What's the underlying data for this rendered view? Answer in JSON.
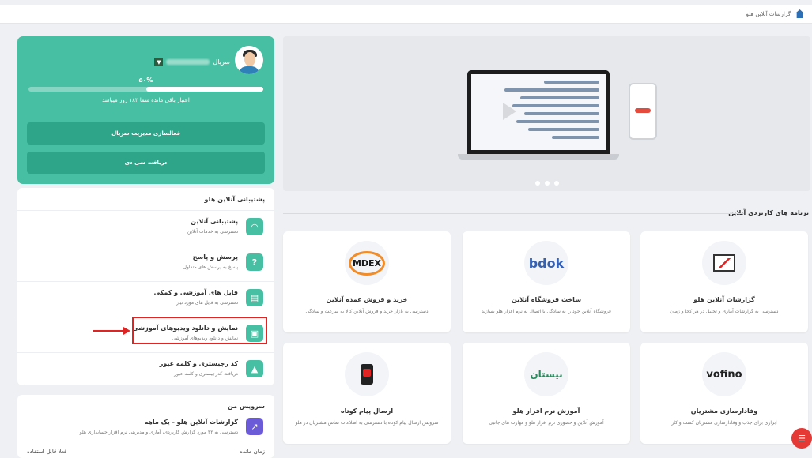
{
  "breadcrumb": {
    "label": "گزارشات آنلاین هلو"
  },
  "subscription": {
    "username_label": "سریال",
    "percent_label": "۵۰%",
    "progress_fraction": 0.5,
    "remaining_text": "اعتبار باقی مانده شما ۱۸۳ روز میباشد",
    "activate_button": "فعالسازی مدیریت سریال",
    "cd_button": "دریافت سی دی"
  },
  "support": {
    "title": "پشتیبانی آنلاین هلو",
    "items": [
      {
        "title": "پشتیبانی آنلاین",
        "desc": "دسترسی به خدمات آنلاین",
        "icon": "headset-icon"
      },
      {
        "title": "پرسش و پاسخ",
        "desc": "پاسخ به پرسش های متداول",
        "icon": "question-icon"
      },
      {
        "title": "فایل های آموزشی و کمکی",
        "desc": "دسترسی به فایل های مورد نیاز",
        "icon": "file-icon"
      },
      {
        "title": "نمایش و دانلود ویدیوهای آموزشی",
        "desc": "نمایش و دانلود ویدیوهای آموزشی",
        "icon": "video-icon"
      },
      {
        "title": "کد رجیستری و کلمه عبور",
        "desc": "دریافت کدرجیستری و کلمه عبور",
        "icon": "lock-icon"
      }
    ]
  },
  "services": {
    "title": "سرویس من",
    "item_title": "گزارشات آنلاین هلو - یک ماهه",
    "item_desc": "دسترسی به ۳۲ مورد گزارش کاربردی، آماری و مدیریتی نرم افزار حسابداری هلو",
    "remaining_label": "زمان مانده",
    "status_label": "فعلا قابل استفاده"
  },
  "apps": {
    "title": "برنامه های کاربردی آنلاین",
    "cards": [
      {
        "title": "گزارشات آنلاین هلو",
        "desc": "دسترسی به گزارشات آماری و تحلیل در هر کجا و زمان",
        "logo": "chart-logo"
      },
      {
        "title": "ساخت فروشگاه آنلاین",
        "desc": "فروشگاه آنلاین خود را به سادگی با اتصال به نرم افزار هلو بسازید",
        "logo": "bdok"
      },
      {
        "title": "خرید و فروش عمده آنلاین",
        "desc": "دسترسی به بازار خرید و فروش آنلاین کالا به سرعت و سادگی",
        "logo": "MDEX"
      },
      {
        "title": "وفادارسازی مشتریان",
        "desc": "ابزاری برای جذب و وفادارسازی مشتریان کسب و کار",
        "logo": "vofino"
      },
      {
        "title": "آموزش نرم افزار هلو",
        "desc": "آموزش آنلاین و حضوری نرم افزار هلو و مهارت های جانبی",
        "logo": "بیستان"
      },
      {
        "title": "ارسال پیام کوتاه",
        "desc": "سرویس ارسال پیام کوتاه با دسترسی به اطلاعات تماس مشتریان در هلو",
        "logo": "sms-logo"
      }
    ]
  }
}
